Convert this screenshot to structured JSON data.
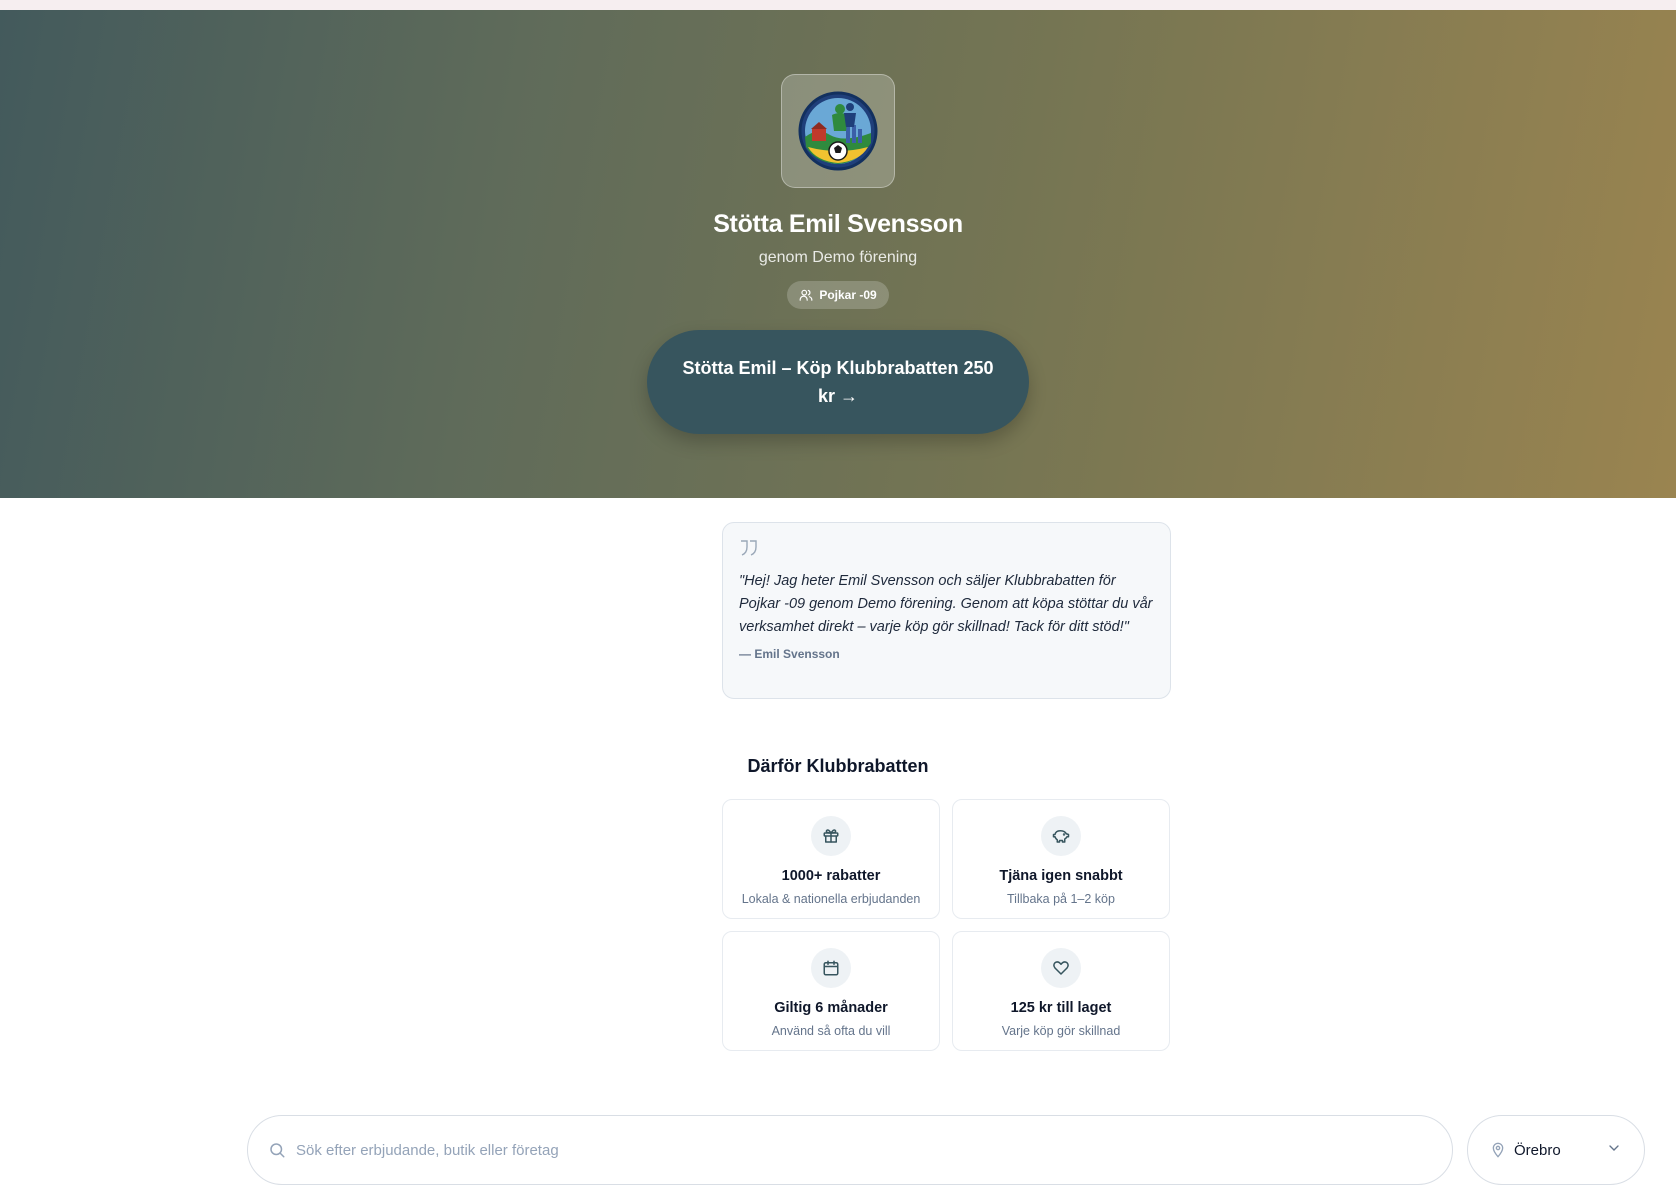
{
  "hero": {
    "title": "Stötta Emil Svensson",
    "subtitle": "genom Demo förening",
    "team_badge": "Pojkar -09",
    "cta_label": "Stötta Emil – Köp Klubbrabatten 250 kr →"
  },
  "quote": {
    "text": "\"Hej! Jag heter Emil Svensson och säljer Klubbrabatten för Pojkar -09 genom Demo förening. Genom att köpa stöttar du vår verksamhet direkt – varje köp gör skillnad! Tack för ditt stöd!\"",
    "author": "— Emil Svensson"
  },
  "features": {
    "title": "Därför Klubbrabatten",
    "items": [
      {
        "icon": "gift-icon",
        "title": "1000+ rabatter",
        "subtitle": "Lokala & nationella erbjudanden"
      },
      {
        "icon": "piggy-bank-icon",
        "title": "Tjäna igen snabbt",
        "subtitle": "Tillbaka på 1–2 köp"
      },
      {
        "icon": "calendar-icon",
        "title": "Giltig 6 månader",
        "subtitle": "Använd så ofta du vill"
      },
      {
        "icon": "heart-icon",
        "title": "125 kr till laget",
        "subtitle": "Varje köp gör skillnad"
      }
    ]
  },
  "search": {
    "placeholder": "Sök efter erbjudande, butik eller företag",
    "location": "Örebro"
  },
  "colors": {
    "cta": "#37555e",
    "hero_gradient_start": "#435a5c",
    "hero_gradient_end": "#9a8450"
  }
}
